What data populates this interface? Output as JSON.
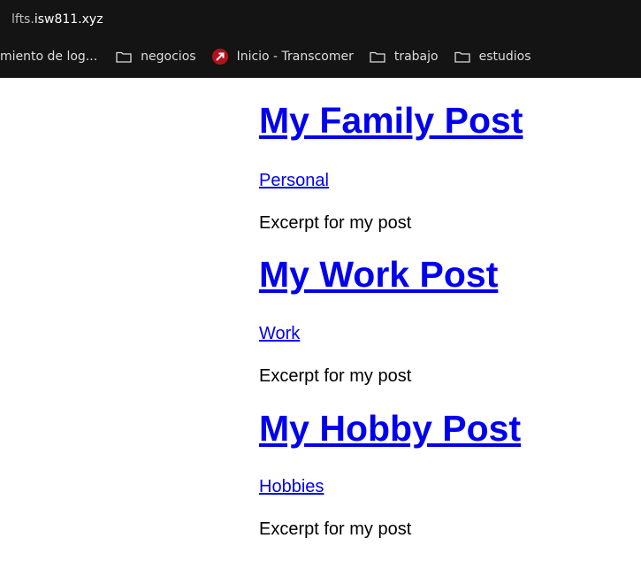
{
  "browser": {
    "url_prefix": "lfts.",
    "url_domain": "isw811.xyz",
    "bookmarks": [
      {
        "label": "miento de log...",
        "icon": "none"
      },
      {
        "label": "negocios",
        "icon": "folder-icon"
      },
      {
        "label": "Inicio - Transcomer",
        "icon": "transcomer-logo-icon"
      },
      {
        "label": "trabajo",
        "icon": "folder-icon"
      },
      {
        "label": "estudios",
        "icon": "folder-icon"
      }
    ]
  },
  "posts": [
    {
      "title": "My Family Post",
      "category": "Personal",
      "excerpt": "Excerpt for my post"
    },
    {
      "title": "My Work Post",
      "category": "Work",
      "excerpt": "Excerpt for my post"
    },
    {
      "title": "My Hobby Post",
      "category": "Hobbies",
      "excerpt": "Excerpt for my post"
    }
  ],
  "colors": {
    "link": "#0000ee",
    "chrome_bg": "#141414"
  }
}
